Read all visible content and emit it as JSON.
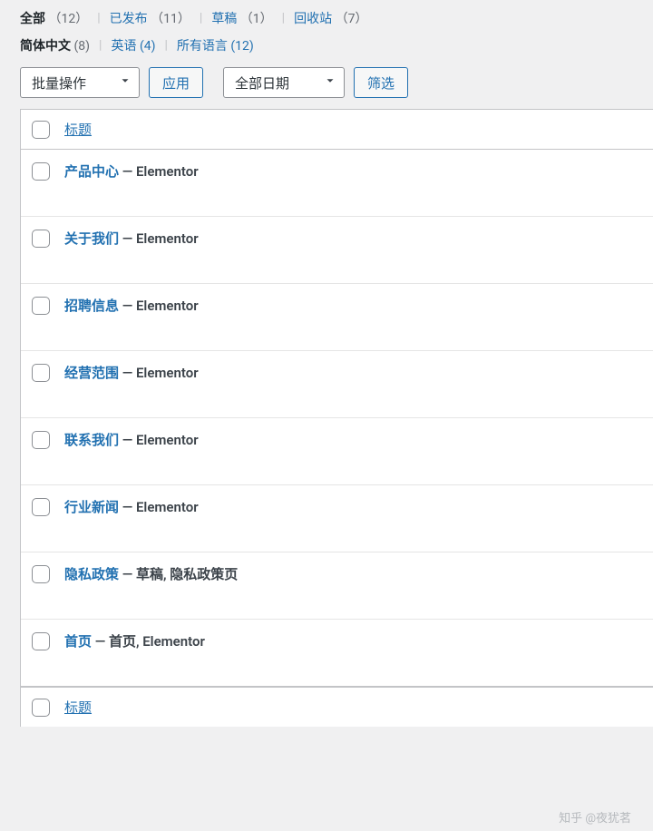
{
  "filters": {
    "items": [
      {
        "label": "全部",
        "count": "（12）",
        "current": true
      },
      {
        "label": "已发布",
        "count": "（11）",
        "current": false
      },
      {
        "label": "草稿",
        "count": "（1）",
        "current": false
      },
      {
        "label": "回收站",
        "count": "（7）",
        "current": false
      }
    ]
  },
  "languages": {
    "items": [
      {
        "label": "简体中文",
        "count": "(8)",
        "current": true
      },
      {
        "label": "英语",
        "count": "(4)",
        "current": false
      },
      {
        "label": "所有语言",
        "count": "(12)",
        "current": false
      }
    ]
  },
  "actions": {
    "bulk_select_label": "批量操作",
    "apply_label": "应用",
    "date_select_label": "全部日期",
    "filter_label": "筛选"
  },
  "table": {
    "header_title": "标题",
    "footer_title": "标题",
    "rows": [
      {
        "title": "产品中心",
        "suffix": " — Elementor"
      },
      {
        "title": "关于我们",
        "suffix": " — Elementor"
      },
      {
        "title": "招聘信息",
        "suffix": " — Elementor"
      },
      {
        "title": "经营范围",
        "suffix": " — Elementor"
      },
      {
        "title": "联系我们",
        "suffix": " — Elementor"
      },
      {
        "title": "行业新闻",
        "suffix": " — Elementor"
      },
      {
        "title": "隐私政策",
        "suffix": " — 草稿, 隐私政策页"
      },
      {
        "title": "首页",
        "suffix": " — 首页, Elementor"
      }
    ]
  },
  "watermark": "知乎 @夜犹茗"
}
